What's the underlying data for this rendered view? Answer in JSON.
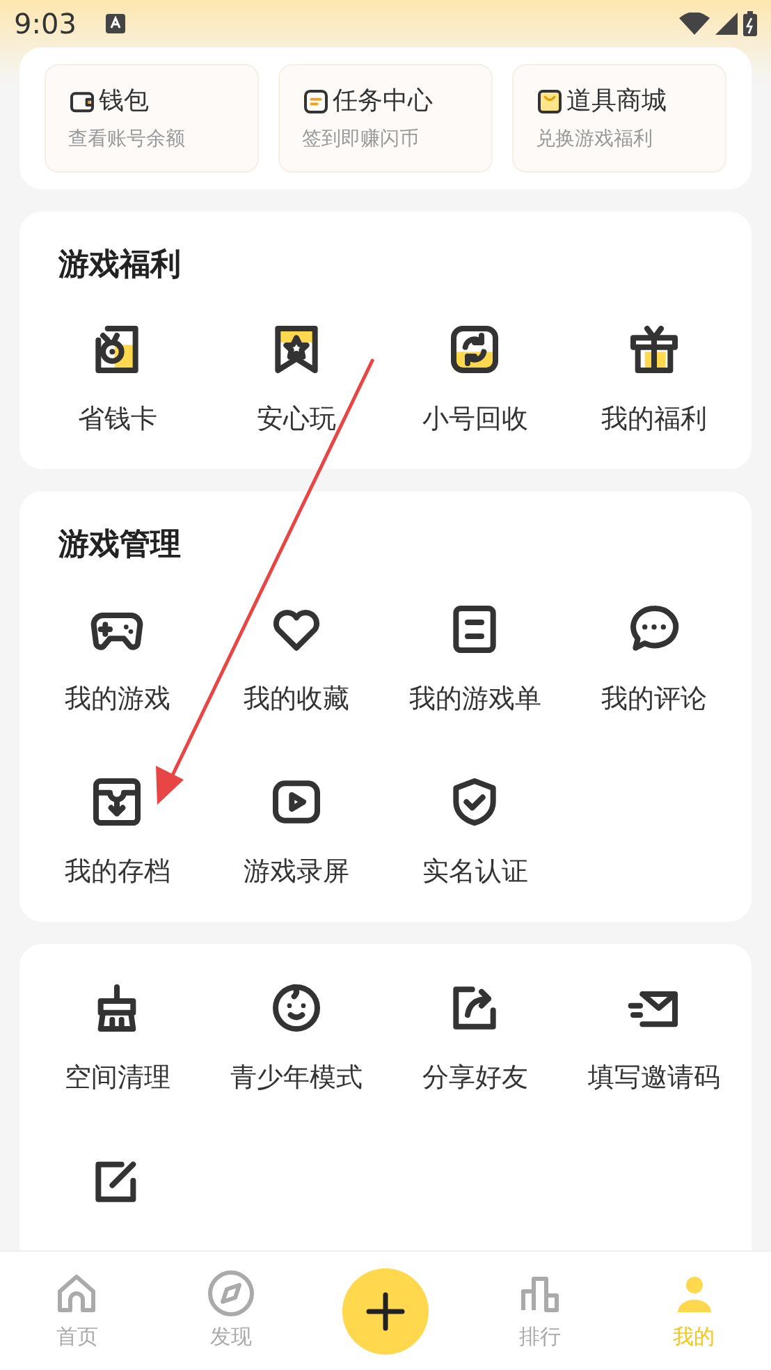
{
  "status_bar": {
    "time": "9:03"
  },
  "quick_links": [
    {
      "title": "钱包",
      "subtitle": "查看账号余额"
    },
    {
      "title": "任务中心",
      "subtitle": "签到即赚闪币"
    },
    {
      "title": "道具商城",
      "subtitle": "兑换游戏福利"
    }
  ],
  "sections": [
    {
      "title": "游戏福利",
      "items": [
        {
          "kind": "shortcut",
          "label": "省钱卡"
        },
        {
          "kind": "shortcut",
          "label": "安心玩"
        },
        {
          "kind": "shortcut",
          "label": "小号回收"
        },
        {
          "kind": "shortcut",
          "label": "我的福利"
        }
      ]
    },
    {
      "title": "游戏管理",
      "items": [
        {
          "kind": "shortcut",
          "label": "我的游戏"
        },
        {
          "kind": "shortcut",
          "label": "我的收藏"
        },
        {
          "kind": "shortcut",
          "label": "我的游戏单"
        },
        {
          "kind": "shortcut",
          "label": "我的评论"
        },
        {
          "kind": "shortcut",
          "label": "我的存档"
        },
        {
          "kind": "shortcut",
          "label": "游戏录屏"
        },
        {
          "kind": "shortcut",
          "label": "实名认证"
        }
      ]
    },
    {
      "items": [
        {
          "kind": "shortcut",
          "label": "空间清理"
        },
        {
          "kind": "shortcut",
          "label": "青少年模式"
        },
        {
          "kind": "shortcut",
          "label": "分享好友"
        },
        {
          "kind": "shortcut",
          "label": "填写邀请码"
        },
        {
          "kind": "icon_only"
        }
      ]
    }
  ],
  "bottom_nav": [
    {
      "kind": "tab",
      "label": "首页",
      "selected": false
    },
    {
      "kind": "tab",
      "label": "发现",
      "selected": false
    },
    {
      "kind": "action"
    },
    {
      "kind": "tab",
      "label": "排行",
      "selected": false
    },
    {
      "kind": "tab",
      "label": "我的",
      "selected": true
    }
  ]
}
